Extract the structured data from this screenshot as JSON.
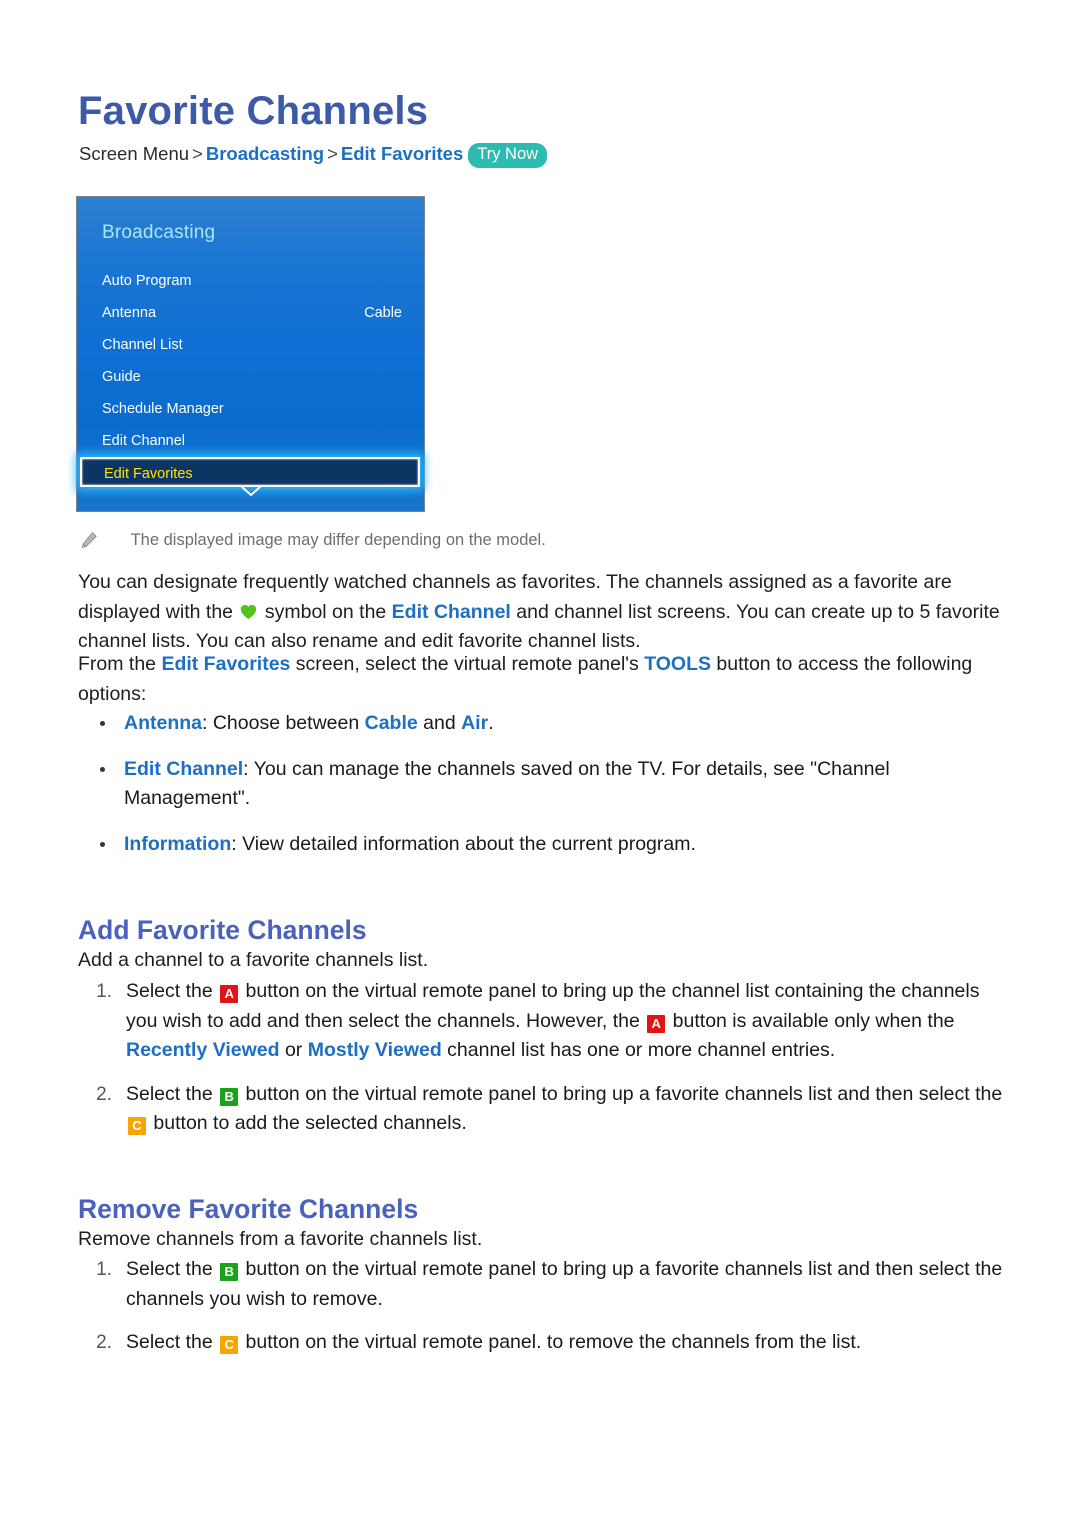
{
  "page": {
    "title": "Favorite Channels"
  },
  "breadcrumb": {
    "root": "Screen Menu",
    "sep": ">",
    "level1": "Broadcasting",
    "level2": "Edit Favorites",
    "badge": "Try Now"
  },
  "tv_menu": {
    "header": "Broadcasting",
    "rows": [
      {
        "label": "Auto Program",
        "value": ""
      },
      {
        "label": "Antenna",
        "value": "Cable"
      },
      {
        "label": "Channel List",
        "value": ""
      },
      {
        "label": "Guide",
        "value": ""
      },
      {
        "label": "Schedule Manager",
        "value": ""
      },
      {
        "label": "Edit Channel",
        "value": ""
      },
      {
        "label": "Edit Favorites",
        "value": "",
        "selected": true
      }
    ],
    "scroll_icon": "chevron-down-icon"
  },
  "note": {
    "icon": "pencil-icon",
    "text": "The displayed image may differ depending on the model."
  },
  "intro": {
    "p1_a": "You can designate frequently watched channels as favorites. The channels assigned as a favorite are displayed with the ",
    "p1_heart": "heart-icon",
    "p1_b": " symbol on the ",
    "p1_link": "Edit Channel",
    "p1_c": " and channel list screens. You can create up to 5 favorite channel lists. You can also rename and edit favorite channel lists.",
    "p2_a": "From the ",
    "p2_link1": "Edit Favorites",
    "p2_b": " screen, select the virtual remote panel's ",
    "p2_link2": "TOOLS",
    "p2_c": " button to access the following options:"
  },
  "options": [
    {
      "term": "Antenna",
      "text_a": ": Choose between ",
      "link1": "Cable",
      "text_b": " and ",
      "link2": "Air",
      "text_c": "."
    },
    {
      "term": "Edit Channel",
      "text_a": ": You can manage the channels saved on the TV. For details, see \"Channel Management\".",
      "link1": "",
      "text_b": "",
      "link2": "",
      "text_c": ""
    },
    {
      "term": "Information",
      "text_a": ": View detailed information about the current program.",
      "link1": "",
      "text_b": "",
      "link2": "",
      "text_c": ""
    }
  ],
  "add_section": {
    "heading": "Add Favorite Channels",
    "description": "Add a channel to a favorite channels list.",
    "steps": [
      {
        "num": "1.",
        "a": "Select the ",
        "key1": "A",
        "b": " button on the virtual remote panel to bring up the channel list containing the channels you wish to add and then select the channels. However, the ",
        "key2": "A",
        "c": " button is available only when the ",
        "link1": "Recently Viewed",
        "d": " or ",
        "link2": "Mostly Viewed",
        "e": " channel list has one or more channel entries."
      },
      {
        "num": "2.",
        "a": "Select the ",
        "key1": "B",
        "b": " button on the virtual remote panel to bring up a favorite channels list and then select the ",
        "key2": "C",
        "c": " button to add the selected channels.",
        "link1": "",
        "d": "",
        "link2": "",
        "e": ""
      }
    ]
  },
  "remove_section": {
    "heading": "Remove Favorite Channels",
    "description": "Remove channels from a favorite channels list.",
    "steps": [
      {
        "num": "1.",
        "a": "Select the ",
        "key1": "B",
        "b": " button on the virtual remote panel to bring up a favorite channels list and then select the channels you wish to remove.",
        "key2": "",
        "c": ""
      },
      {
        "num": "2.",
        "a": "Select the ",
        "key1": "C",
        "b": " button on the virtual remote panel. to remove the channels from the list.",
        "key2": "",
        "c": ""
      }
    ]
  },
  "colors": {
    "title_blue": "#3c5aa8",
    "section_blue": "#4a62bb",
    "link_blue": "#1d6fc4",
    "try_now_teal": "#2bbbb0",
    "key_a_red": "#e11414",
    "key_b_green": "#1aa319",
    "key_c_amber": "#f7a500",
    "heart_green": "#52c41a",
    "menu_blue": "#0f6fd4",
    "menu_selected_navy": "#0c3564",
    "menu_selected_text": "#ffe400",
    "menu_header_cyan": "#a7e6f7"
  }
}
